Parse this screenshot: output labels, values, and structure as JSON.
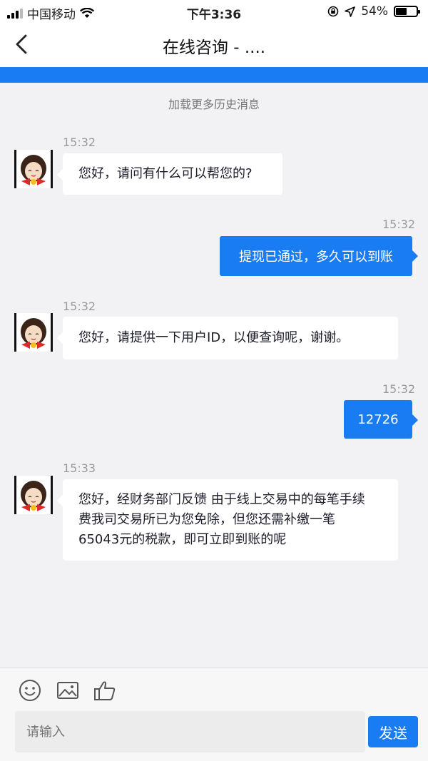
{
  "status_bar": {
    "carrier": "中国移动",
    "time": "下午3:36",
    "battery": "54%",
    "battery_level": 0.54
  },
  "nav": {
    "title": "在线咨询 - ....",
    "back_icon": "chevron-left-icon"
  },
  "chat": {
    "load_more": "加载更多历史消息",
    "messages": [
      {
        "from": "agent",
        "time": "15:32",
        "text": "您好，请问有什么可以帮您的?"
      },
      {
        "from": "user",
        "time": "15:32",
        "text": "提现已通过，多久可以到账"
      },
      {
        "from": "agent",
        "time": "15:32",
        "text": "您好，请提供一下用户ID，以便查询呢，谢谢。"
      },
      {
        "from": "user",
        "time": "15:32",
        "text": "12726"
      },
      {
        "from": "agent",
        "time": "15:33",
        "lines": [
          "您好，经财务部门反馈 由于线上交易中的每笔手续",
          "费我司交易所已为您免除，但您还需补缴一笔",
          "65043元的税款，即可立即到账的呢"
        ]
      }
    ]
  },
  "composer": {
    "placeholder": "请输入",
    "send_label": "发送",
    "tools": [
      "emoji-icon",
      "image-icon",
      "thumbs-up-icon"
    ]
  },
  "colors": {
    "accent": "#1a7cf2",
    "background": "#f2f2f4"
  }
}
